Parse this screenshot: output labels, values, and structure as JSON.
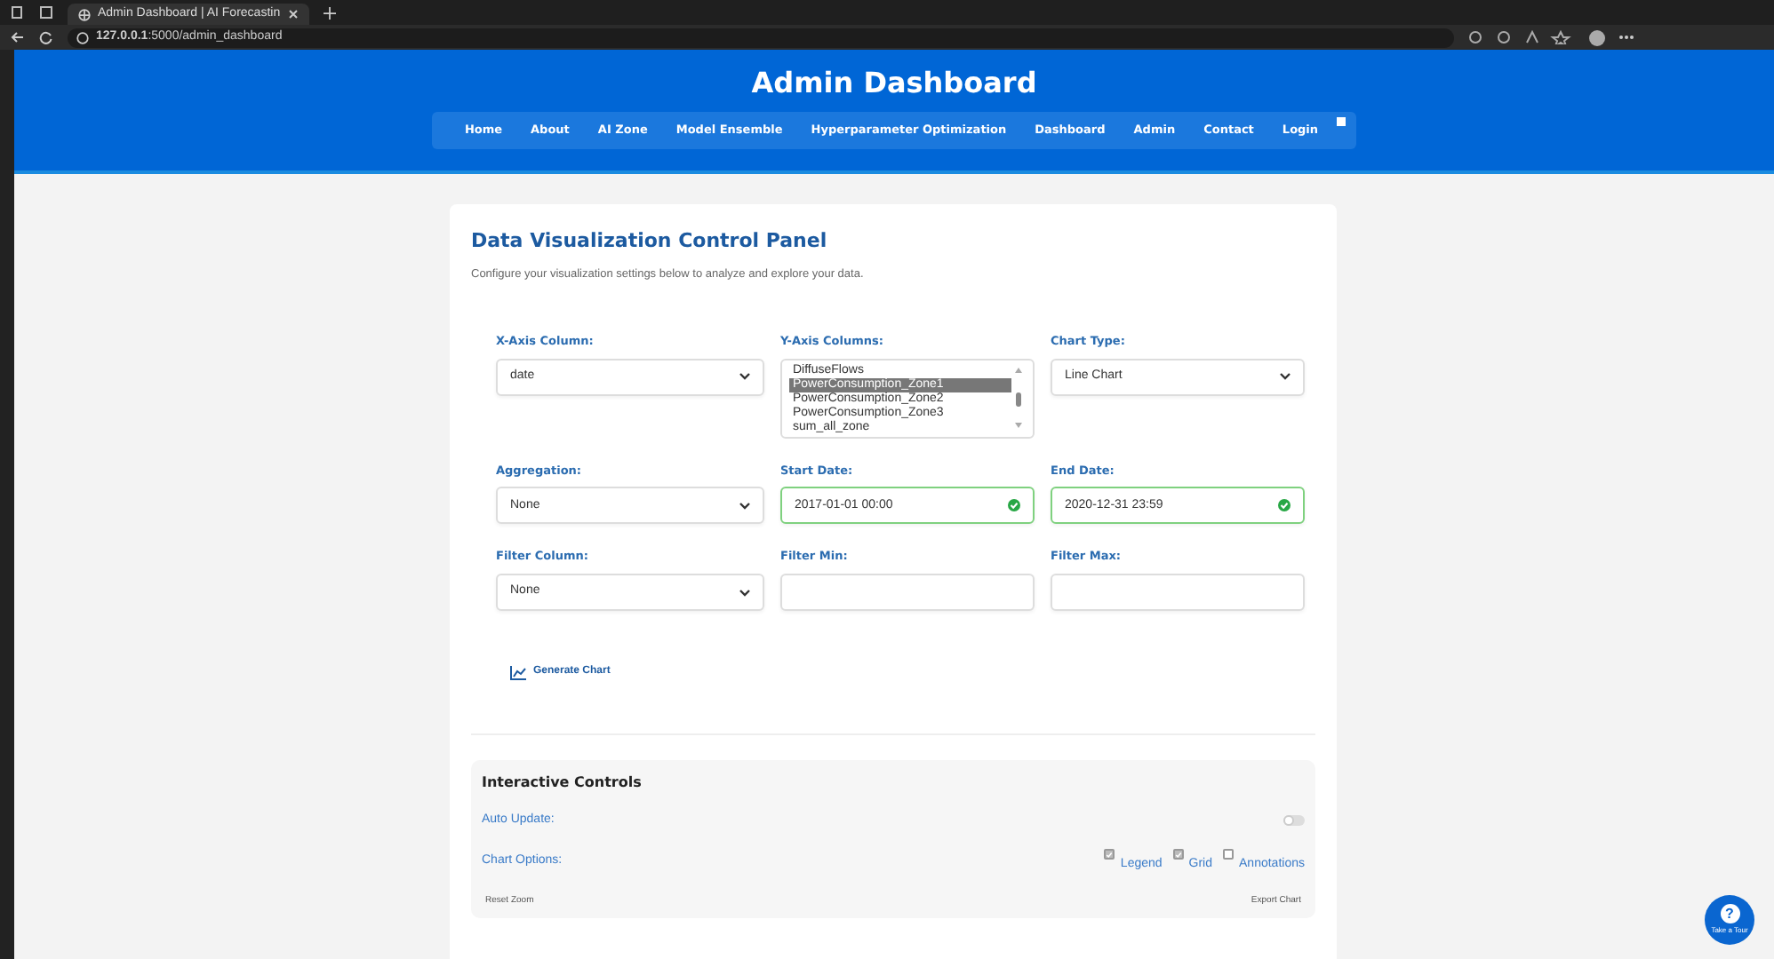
{
  "browser": {
    "tab_title": "Admin Dashboard | AI Forecastin",
    "url_host": "127.0.0.1",
    "url_path": ":5000/admin_dashboard"
  },
  "header": {
    "title": "Admin Dashboard",
    "nav": [
      {
        "label": "Home"
      },
      {
        "label": "About"
      },
      {
        "label": "AI Zone"
      },
      {
        "label": "Model Ensemble"
      },
      {
        "label": "Hyperparameter Optimization"
      },
      {
        "label": "Dashboard"
      },
      {
        "label": "Admin"
      },
      {
        "label": "Contact"
      },
      {
        "label": "Login"
      }
    ]
  },
  "panel": {
    "title": "Data Visualization Control Panel",
    "description": "Configure your visualization settings below to analyze and explore your data.",
    "fields": [
      {
        "kind": "select",
        "label": "X-Axis Column:",
        "value": "date"
      },
      {
        "kind": "listbox",
        "label": "Y-Axis Columns:",
        "options": [
          {
            "label": "DiffuseFlows",
            "selected": false
          },
          {
            "label": "PowerConsumption_Zone1",
            "selected": true
          },
          {
            "label": "PowerConsumption_Zone2",
            "selected": false
          },
          {
            "label": "PowerConsumption_Zone3",
            "selected": false
          },
          {
            "label": "sum_all_zone",
            "selected": false
          }
        ]
      },
      {
        "kind": "select",
        "label": "Chart Type:",
        "value": "Line Chart"
      },
      {
        "kind": "select",
        "label": "Aggregation:",
        "value": "None"
      },
      {
        "kind": "input",
        "label": "Start Date:",
        "value": "2017-01-01 00:00",
        "valid": true
      },
      {
        "kind": "input",
        "label": "End Date:",
        "value": "2020-12-31 23:59",
        "valid": true
      },
      {
        "kind": "select",
        "label": "Filter Column:",
        "value": "None"
      },
      {
        "kind": "input",
        "label": "Filter Min:",
        "valid": false
      },
      {
        "kind": "input",
        "label": "Filter Max:",
        "valid": false
      }
    ],
    "generate_button": "Generate Chart"
  },
  "interactive": {
    "title": "Interactive Controls",
    "auto_update": {
      "label": "Auto Update:",
      "on": false
    },
    "chart_options": {
      "label": "Chart Options:",
      "options": [
        {
          "label": "Legend",
          "checked": true
        },
        {
          "label": "Grid",
          "checked": true
        },
        {
          "label": "Annotations",
          "checked": false
        }
      ]
    },
    "reset_button": "Reset Zoom",
    "export_button": "Export Chart"
  },
  "tour_button": {
    "icon": "?",
    "label": "Take a Tour"
  }
}
